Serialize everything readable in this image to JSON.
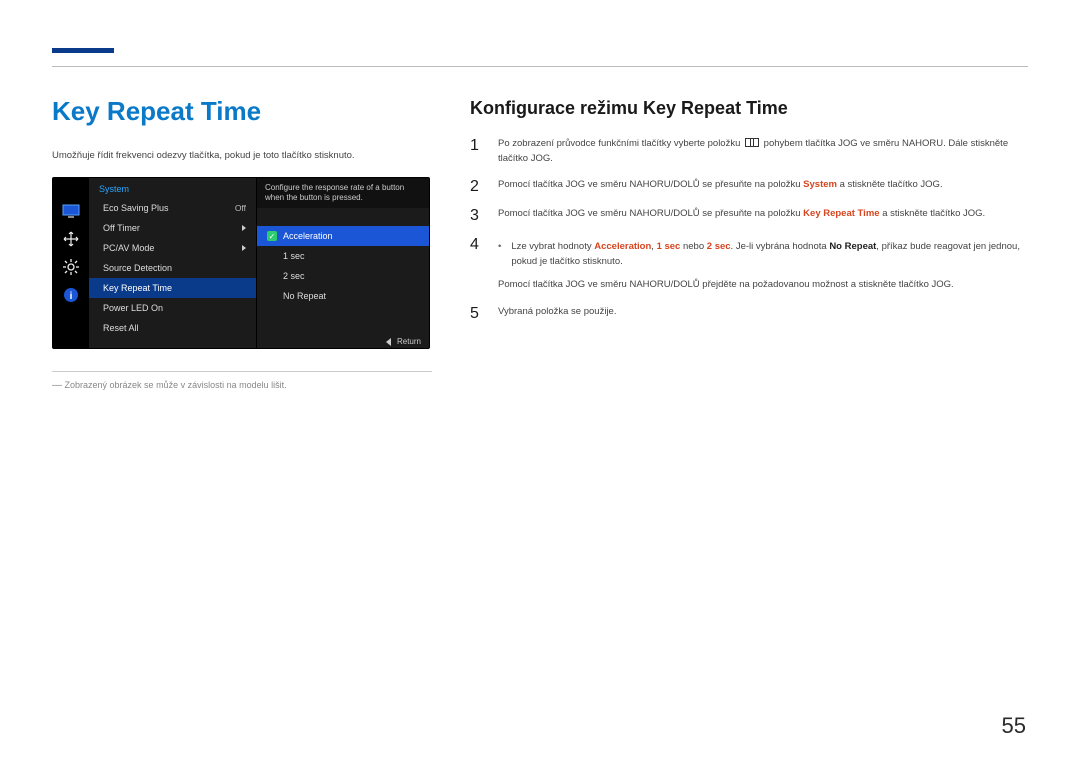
{
  "header": {
    "page_number": "55"
  },
  "left": {
    "title": "Key Repeat Time",
    "lead": "Umožňuje řídit frekvenci odezvy tlačítka, pokud je toto tlačítko stisknuto.",
    "footnote": "Zobrazený obrázek se může v závislosti na modelu lišit."
  },
  "osd": {
    "section_title": "System",
    "rows": [
      {
        "label": "Eco Saving Plus",
        "value": "Off"
      },
      {
        "label": "Off Timer",
        "value": "▸"
      },
      {
        "label": "PC/AV Mode",
        "value": "▸"
      },
      {
        "label": "Source Detection",
        "value": ""
      },
      {
        "label": "Key Repeat Time",
        "value": "",
        "selected": true
      },
      {
        "label": "Power LED On",
        "value": ""
      },
      {
        "label": "Reset All",
        "value": ""
      }
    ],
    "tooltip": "Configure the response rate of a button when the button is pressed.",
    "options": [
      {
        "label": "Acceleration",
        "selected": true
      },
      {
        "label": "1 sec"
      },
      {
        "label": "2 sec"
      },
      {
        "label": "No Repeat"
      }
    ],
    "return_label": "Return"
  },
  "right": {
    "heading": "Konfigurace režimu Key Repeat Time",
    "steps": {
      "s1a": "Po zobrazení průvodce funkčními tlačítky vyberte položku ",
      "s1b": " pohybem tlačítka JOG ve směru NAHORU. Dále stiskněte tlačítko JOG.",
      "s2a": "Pomocí tlačítka JOG ve směru NAHORU/DOLŮ se přesuňte na položku ",
      "s2b": "System",
      "s2c": " a stiskněte tlačítko JOG.",
      "s3a": "Pomocí tlačítka JOG ve směru NAHORU/DOLŮ se přesuňte na položku ",
      "s3b": "Key Repeat Time",
      "s3c": " a stiskněte tlačítko JOG.",
      "s4_bullet_a": "Lze vybrat hodnoty ",
      "s4_acc": "Acceleration",
      "s4_comma": ", ",
      "s4_1s": "1 sec",
      "s4_or": " nebo ",
      "s4_2s": "2 sec",
      "s4_mid": ". Je-li vybrána hodnota ",
      "s4_nr": "No Repeat",
      "s4_end": ", příkaz bude reagovat jen jednou, pokud je tlačítko stisknuto.",
      "s4": "Pomocí tlačítka JOG ve směru NAHORU/DOLŮ přejděte na požadovanou možnost a stiskněte tlačítko JOG.",
      "s5": "Vybraná položka se použije."
    }
  }
}
